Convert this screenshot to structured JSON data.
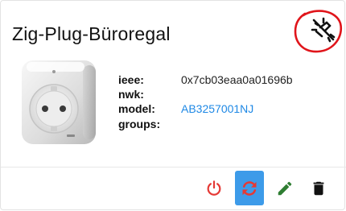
{
  "card": {
    "title": "Zig-Plug-Büroregal"
  },
  "status_icon": "link-off-icon",
  "details": {
    "ieee_label": "ieee:",
    "ieee_value": "0x7cb03eaa0a01696b",
    "nwk_label": "nwk:",
    "nwk_value": "",
    "model_label": "model:",
    "model_value": "AB3257001NJ",
    "groups_label": "groups:",
    "groups_value": ""
  },
  "actions": [
    {
      "name": "power",
      "icon": "power-icon",
      "color": "#e53935"
    },
    {
      "name": "reconfigure",
      "icon": "sync-icon",
      "color": "#e53935",
      "active": true
    },
    {
      "name": "edit",
      "icon": "pencil-icon",
      "color": "#2e7d32"
    },
    {
      "name": "delete",
      "icon": "trash-icon",
      "color": "#111111"
    }
  ],
  "colors": {
    "link": "#1e88e5",
    "active_button_bg": "#3d9be9",
    "annotation_circle": "#e0151b"
  }
}
